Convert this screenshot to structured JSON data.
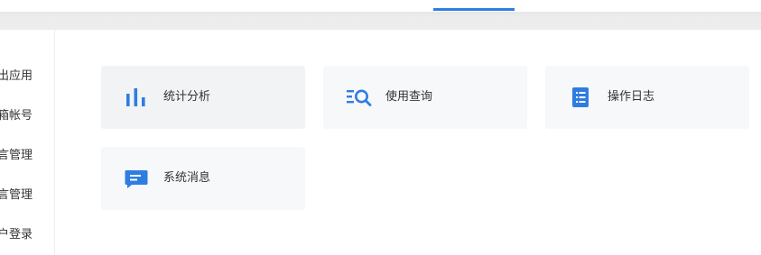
{
  "header": {
    "accent_color": "#2f7de1"
  },
  "sidebar": {
    "items": [
      {
        "label": "出应用"
      },
      {
        "label": "箱帐号"
      },
      {
        "label": "言管理"
      },
      {
        "label": "言管理"
      },
      {
        "label": "户登录"
      }
    ]
  },
  "cards": [
    {
      "label": "统计分析",
      "icon": "bar-chart-icon"
    },
    {
      "label": "使用查询",
      "icon": "list-search-icon"
    },
    {
      "label": "操作日志",
      "icon": "log-list-icon"
    },
    {
      "label": "系统消息",
      "icon": "message-icon"
    }
  ]
}
